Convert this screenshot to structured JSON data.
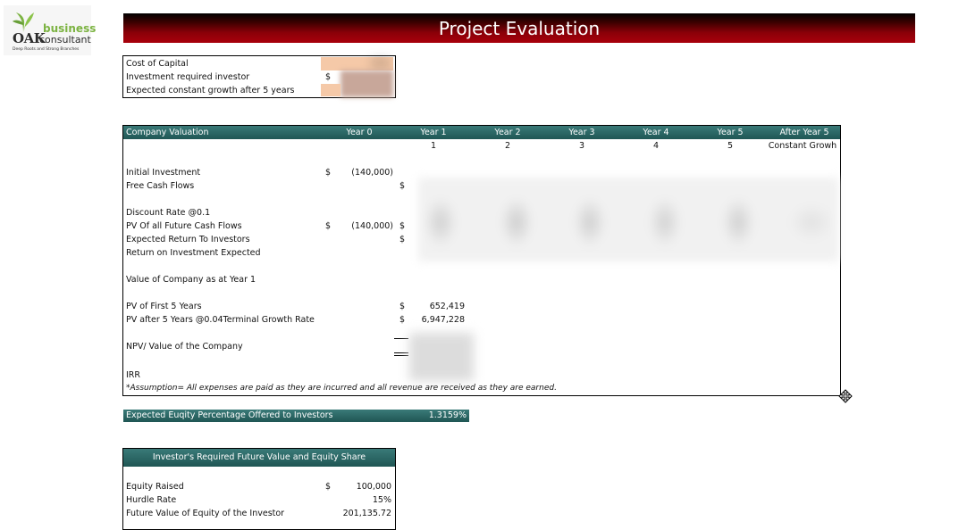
{
  "header": {
    "logo_business": "business",
    "logo_consultant": "consultant",
    "logo_tagline": "Deep Roots and Strong Branches",
    "title": "Project Evaluation"
  },
  "parameters": {
    "rows": [
      {
        "label": "Cost of Capital",
        "currency": "",
        "value": "10%"
      },
      {
        "label": "Investment required investor",
        "currency": "$",
        "value": ""
      },
      {
        "label": "Expected constant growth after 5 years",
        "currency": "",
        "value": ""
      }
    ]
  },
  "valuation": {
    "header_label": "Company Valuation",
    "columns": [
      "Year 0",
      "Year 1",
      "Year 2",
      "Year 3",
      "Year 4",
      "Year 5",
      "After Year 5"
    ],
    "subheader": [
      "",
      "1",
      "2",
      "3",
      "4",
      "5",
      "Constant Growh"
    ],
    "initial_investment": {
      "label": "Initial Investment",
      "currency": "$",
      "value": "(140,000)"
    },
    "free_cash_flows": {
      "label": "Free Cash Flows",
      "currency": "$"
    },
    "discount_rate": {
      "label": "Discount Rate @0.1"
    },
    "pv_future": {
      "label": "PV Of all Future Cash Flows",
      "currency": "$",
      "value": "(140,000)",
      "currency2": "$"
    },
    "expected_return": {
      "label": "Expected Return To Investors",
      "currency": "$"
    },
    "roi": {
      "label": "Return on Investment Expected"
    },
    "value_year1": {
      "label": "Value of Company as at Year 1"
    },
    "pv_first5": {
      "label": "PV of First 5 Years",
      "currency": "$",
      "value": "652,419"
    },
    "pv_after5": {
      "label": "PV after 5 Years @0.04Terminal Growth Rate",
      "currency": "$",
      "value": "6,947,228"
    },
    "npv": {
      "label": "NPV/ Value of the Company"
    },
    "irr": {
      "label": "IRR"
    },
    "assumption": "*Assumption= All expenses are paid as they are incurred and all revenue are received as they are earned."
  },
  "equity": {
    "label": "Expected Euqity Percentage Offered to Investors",
    "value": "1.3159%"
  },
  "investor": {
    "title": "Investor's Required Future Value and Equity Share",
    "rows": [
      {
        "label": "Equity Raised",
        "currency": "$",
        "value": "100,000"
      },
      {
        "label": "Hurdle Rate",
        "currency": "",
        "value": "15%"
      },
      {
        "label": "Future Value of Equity of the Investor",
        "currency": "",
        "value": "201,135.72"
      }
    ]
  },
  "colors": {
    "title_red": "#a9000b",
    "teal": "#2b6a68",
    "input_orange": "#f5c9a8"
  }
}
